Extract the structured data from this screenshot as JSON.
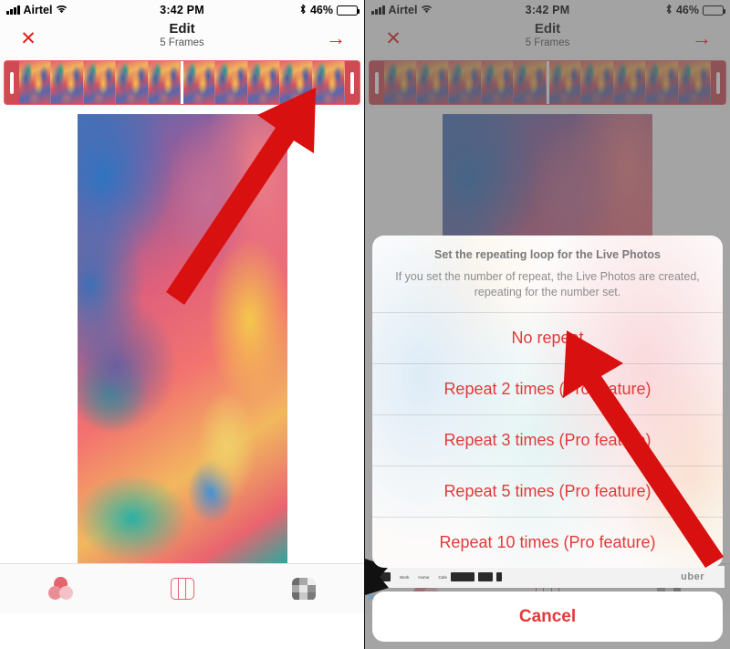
{
  "status_bar": {
    "carrier": "Airtel",
    "time": "3:42 PM",
    "battery_percent": "46%",
    "signal_icon": "signal-bars-icon",
    "wifi_icon": "wifi-icon",
    "bluetooth_icon": "bluetooth-icon",
    "battery_icon": "battery-icon",
    "battery_fill_ratio": 0.46
  },
  "nav_bar": {
    "close_label": "✕",
    "title": "Edit",
    "subtitle": "5 Frames",
    "next_label": "→"
  },
  "filmstrip": {
    "left_handle_name": "trim-handle-left",
    "right_handle_name": "trim-handle-right",
    "frame_count_left": 5,
    "frame_count_right": 5
  },
  "tab_bar": {
    "items": [
      {
        "name": "tab-filters",
        "icon": "overlapping-circles-icon"
      },
      {
        "name": "tab-layout",
        "icon": "three-columns-icon"
      },
      {
        "name": "tab-background",
        "icon": "checkerboard-icon"
      }
    ]
  },
  "action_sheet": {
    "title": "Set the repeating loop for the Live Photos",
    "message": "If you set the number of repeat, the Live Photos are created, repeating for the number set.",
    "options": [
      "No repeat",
      "Repeat 2 times (Pro feature)",
      "Repeat 3 times (Pro feature)",
      "Repeat 5 times (Pro feature)",
      "Repeat 10 times (Pro feature)"
    ],
    "cancel_label": "Cancel"
  },
  "background_strip": {
    "uber_label": "uber"
  },
  "annotations": [
    {
      "name": "arrow-to-next-button",
      "target": "next-button"
    },
    {
      "name": "arrow-to-no-repeat-option",
      "target": "no-repeat-option"
    }
  ],
  "colors": {
    "accent_red": "#e23a3a",
    "nav_red": "#e02020",
    "annotation_red": "#d81010",
    "filmstrip_red": "#cf4a52",
    "status_text": "#000000"
  }
}
